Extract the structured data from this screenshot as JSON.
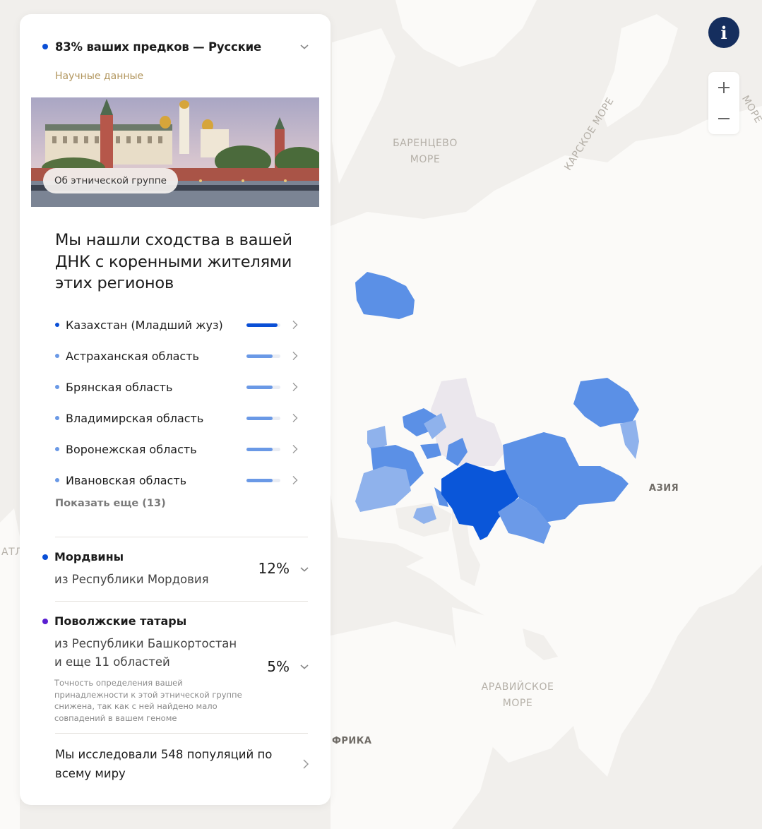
{
  "map": {
    "labels": {
      "barents": [
        "БАРЕНЦЕВО",
        "МОРЕ"
      ],
      "kara": "КАРСКОЕ МОРЕ",
      "arabian": [
        "АРАВИЙСКОЕ",
        "МОРЕ"
      ],
      "asia": "АЗИЯ",
      "africa": "ФРИКА",
      "atlantic": "АТЛ",
      "sea_edge": "МОРЕ"
    },
    "colors": {
      "land": "#fbfaf8",
      "water": "#f1efec",
      "strong": "#0a56d9",
      "medium": "#5b90e6",
      "light": "#8fb2ec",
      "faint": "#ebe7ed"
    }
  },
  "controls": {
    "info_icon": "i",
    "zoom_in_icon": "plus-icon",
    "zoom_out_icon": "minus-icon"
  },
  "panel": {
    "top_title": "83% ваших предков — Русские",
    "top_dot_color": "#0a4fd6",
    "science_link": "Научные данные",
    "hero_button": "Об этнической группе",
    "headline": "Мы нашли сходства в вашей ДНК с коренными жителями этих регионов",
    "regions": [
      {
        "name": "Казахстан (Младший жуз)",
        "level": 0.92,
        "dot_color": "#0a4fd6",
        "bar_color": "#0a4fd6"
      },
      {
        "name": "Астраханская область",
        "level": 0.78,
        "dot_color": "#6a99e6",
        "bar_color": "#6a99e6"
      },
      {
        "name": "Брянская область",
        "level": 0.78,
        "dot_color": "#6a99e6",
        "bar_color": "#6a99e6"
      },
      {
        "name": "Владимирская область",
        "level": 0.78,
        "dot_color": "#6a99e6",
        "bar_color": "#6a99e6"
      },
      {
        "name": "Воронежская область",
        "level": 0.78,
        "dot_color": "#6a99e6",
        "bar_color": "#6a99e6"
      },
      {
        "name": "Ивановская область",
        "level": 0.78,
        "dot_color": "#6a99e6",
        "bar_color": "#6a99e6"
      }
    ],
    "show_more": "Показать еще (13)",
    "ethnic_groups": [
      {
        "name": "Мордвины",
        "subtitle": "из Республики Мордовия",
        "percent": "12%",
        "dot_color": "#0a4fd6",
        "note": ""
      },
      {
        "name": "Поволжские татары",
        "subtitle": "из Республики Башкортостан и еще 11 областей",
        "percent": "5%",
        "dot_color": "#5a1fd1",
        "note": "Точность определения вашей принадлежности к этой этнической группе снижена, так как с ней найдено мало совпадений в вашем геноме"
      }
    ],
    "research_text": "Мы исследовали 548 популяций по всему миру"
  }
}
